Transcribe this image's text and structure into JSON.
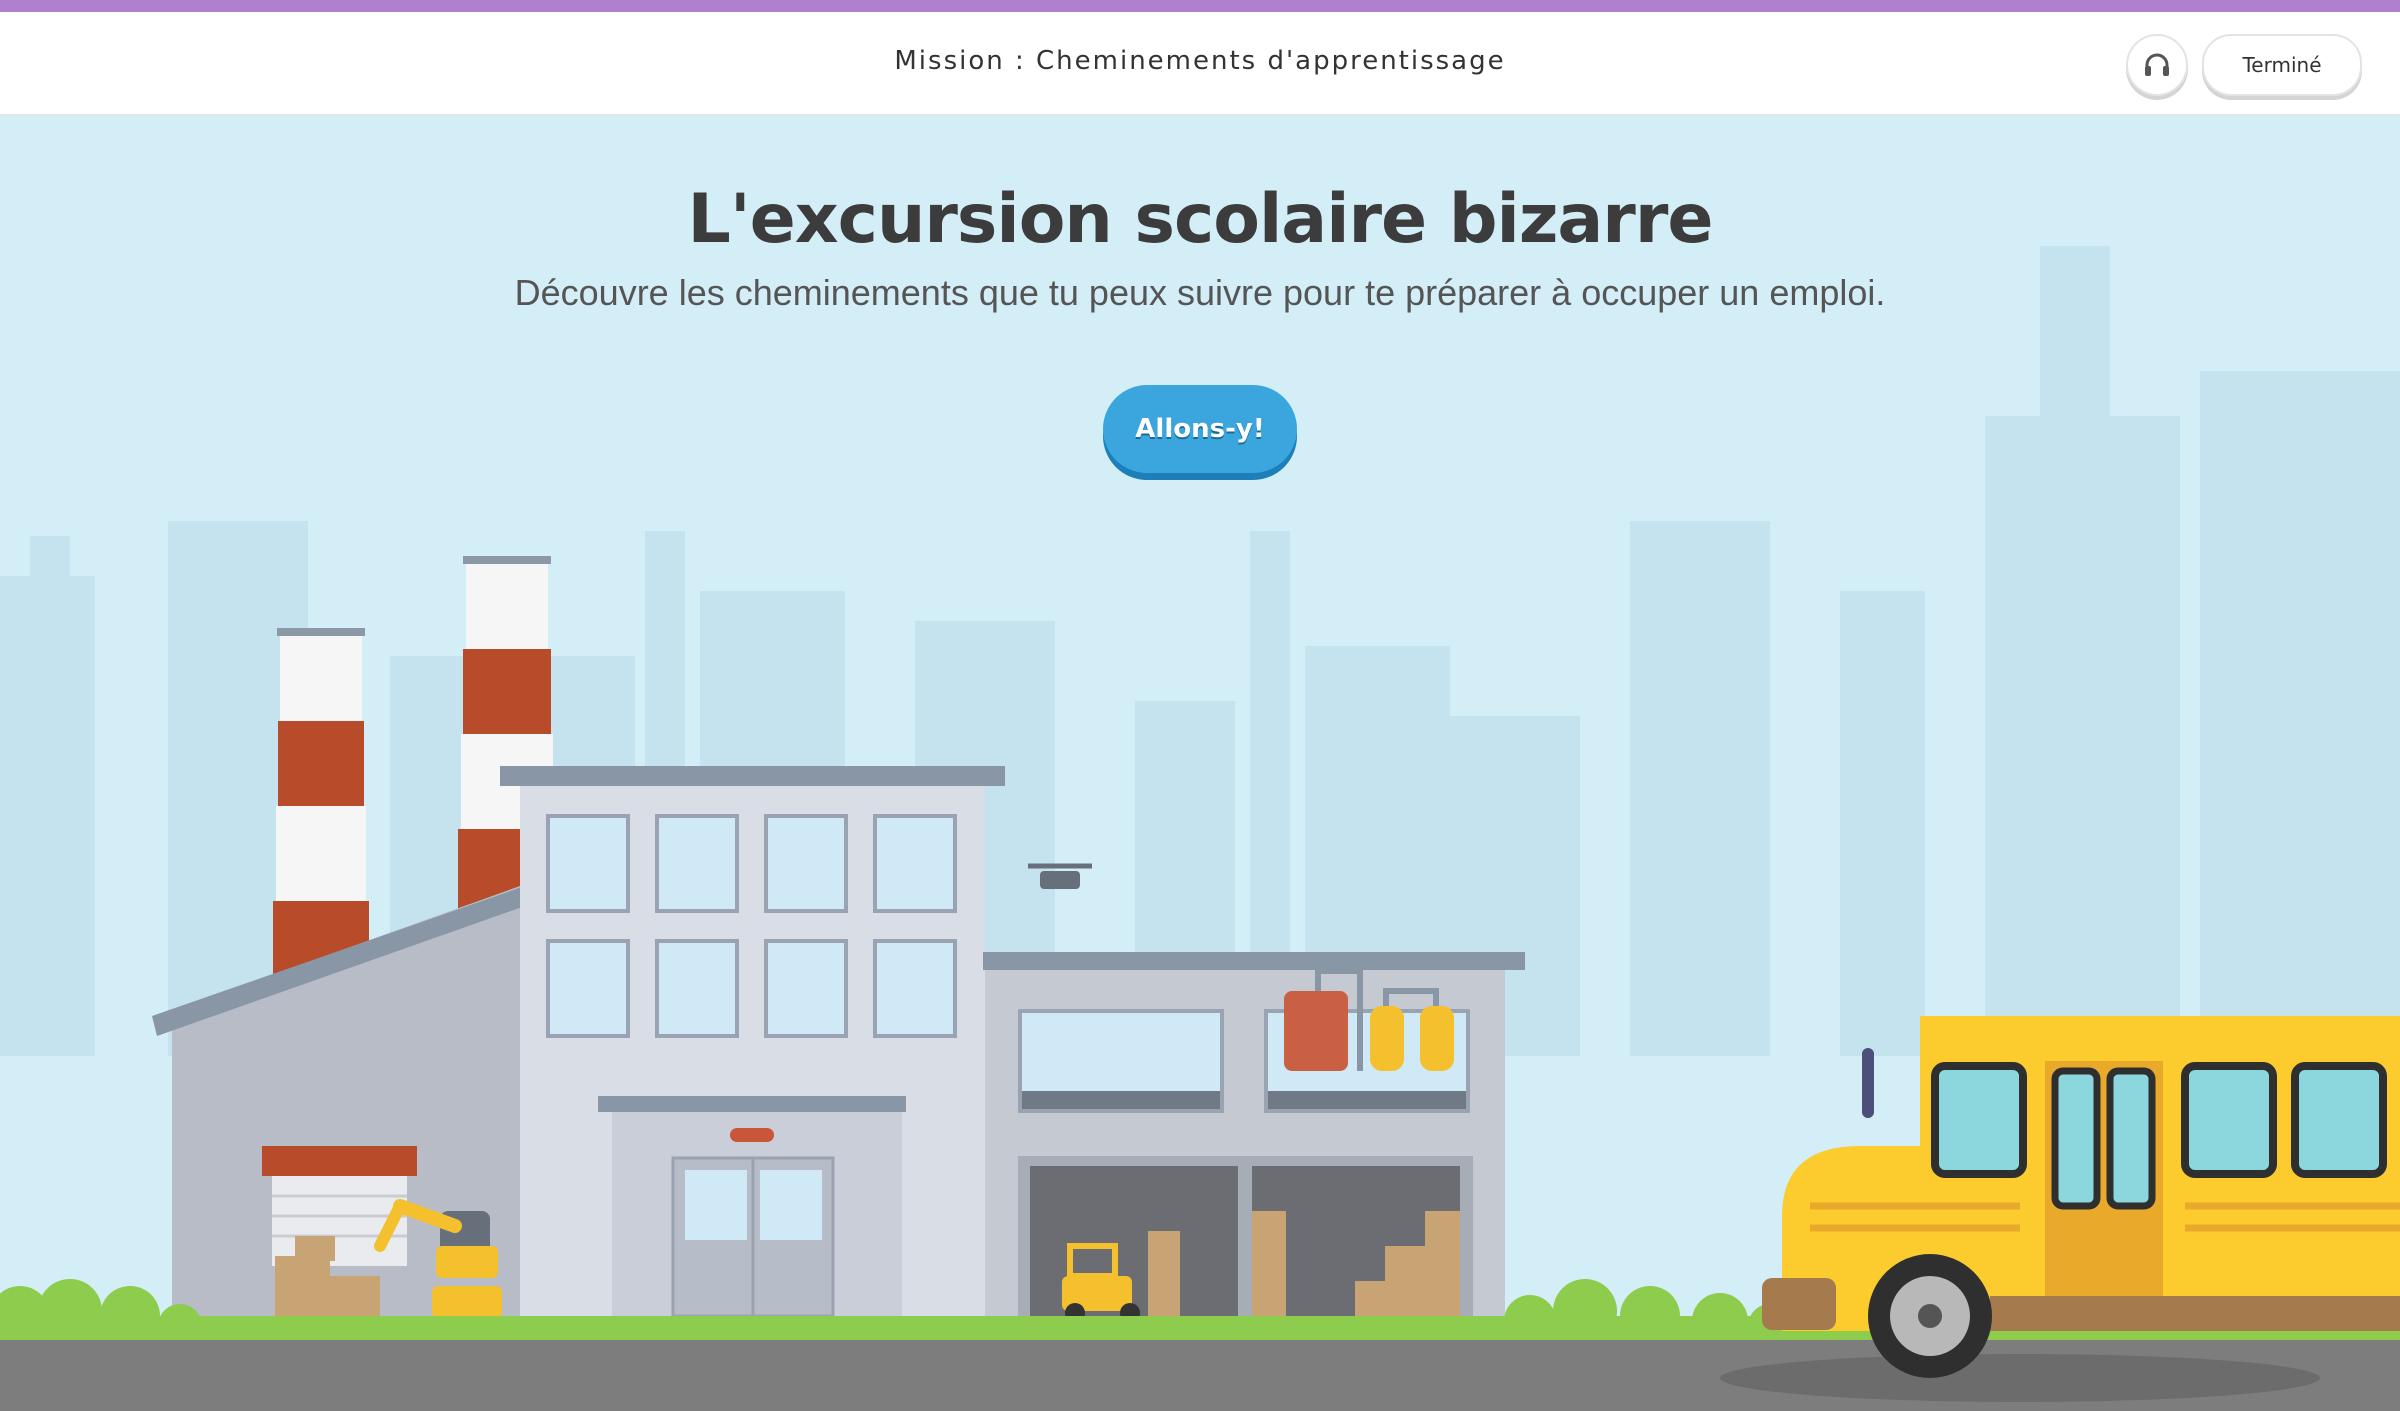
{
  "header": {
    "mission_title": "Mission : Cheminements d'apprentissage",
    "audio_icon": "headphones-icon",
    "done_label": "Terminé"
  },
  "hero": {
    "title": "L'excursion scolaire bizarre",
    "subtitle": "Découvre les cheminements que tu peux suivre pour te préparer à occuper un emploi.",
    "cta_label": "Allons-y!"
  },
  "colors": {
    "top_strip": "#b07fd0",
    "sky": "#d4eef8",
    "skyline": "#c5e3ef",
    "cta": "#3aa6dd",
    "bus": "#fccc2f",
    "grass": "#8dcc4c",
    "road": "#7d7d7d",
    "chimney_red": "#b84b2a"
  }
}
